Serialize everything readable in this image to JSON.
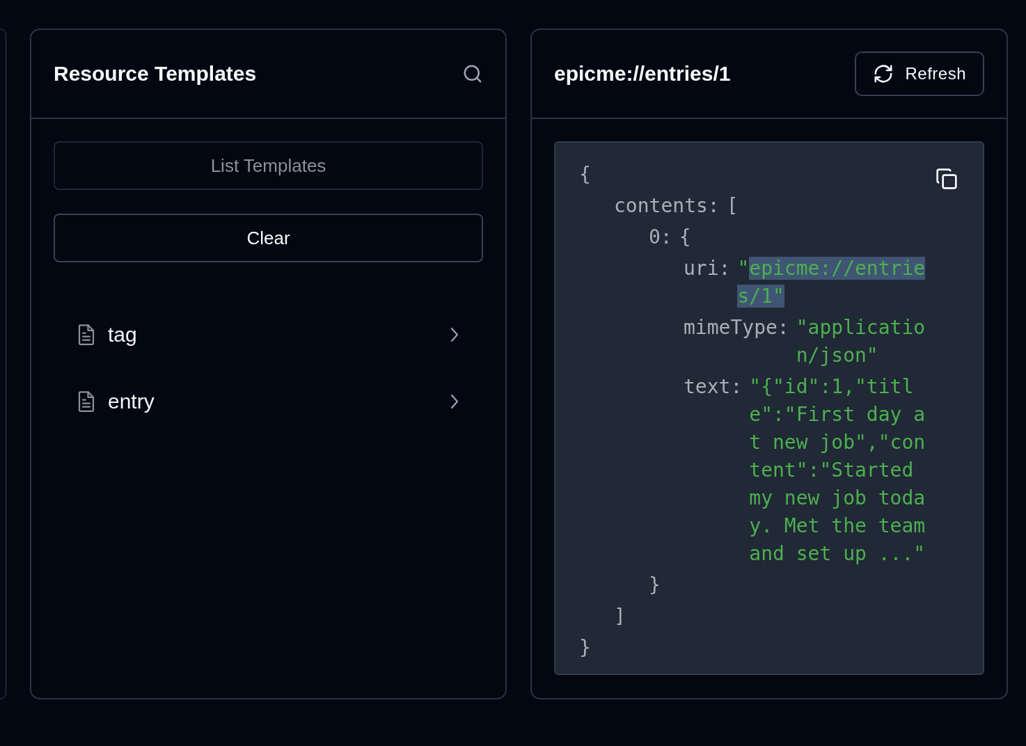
{
  "templates_panel": {
    "title": "Resource Templates",
    "buttons": [
      {
        "label": "List Templates",
        "disabled": true
      },
      {
        "label": "Clear",
        "disabled": false
      }
    ],
    "templates": [
      {
        "name": "tag"
      },
      {
        "name": "entry"
      }
    ]
  },
  "resource_panel": {
    "title": "epicme://entries/1",
    "refresh_button": "Refresh",
    "json_view": {
      "open": "{",
      "close": "}",
      "children": [
        {
          "key": "contents:",
          "open": "[",
          "close": "]",
          "children": [
            {
              "key": "0:",
              "open": "{",
              "close": "}",
              "children": [
                {
                  "key": "uri:",
                  "value": "\"epicme://entries/1\"",
                  "highlighted": true
                },
                {
                  "key": "mimeType:",
                  "value": "\"application/json\"",
                  "highlighted": false
                },
                {
                  "key": "text:",
                  "value": "\"{\"id\":1,\"title\":\"First day at new job\",\"content\":\"Started my new job today. Met the team and set up ...\"",
                  "highlighted": false
                }
              ]
            }
          ]
        }
      ]
    }
  }
}
